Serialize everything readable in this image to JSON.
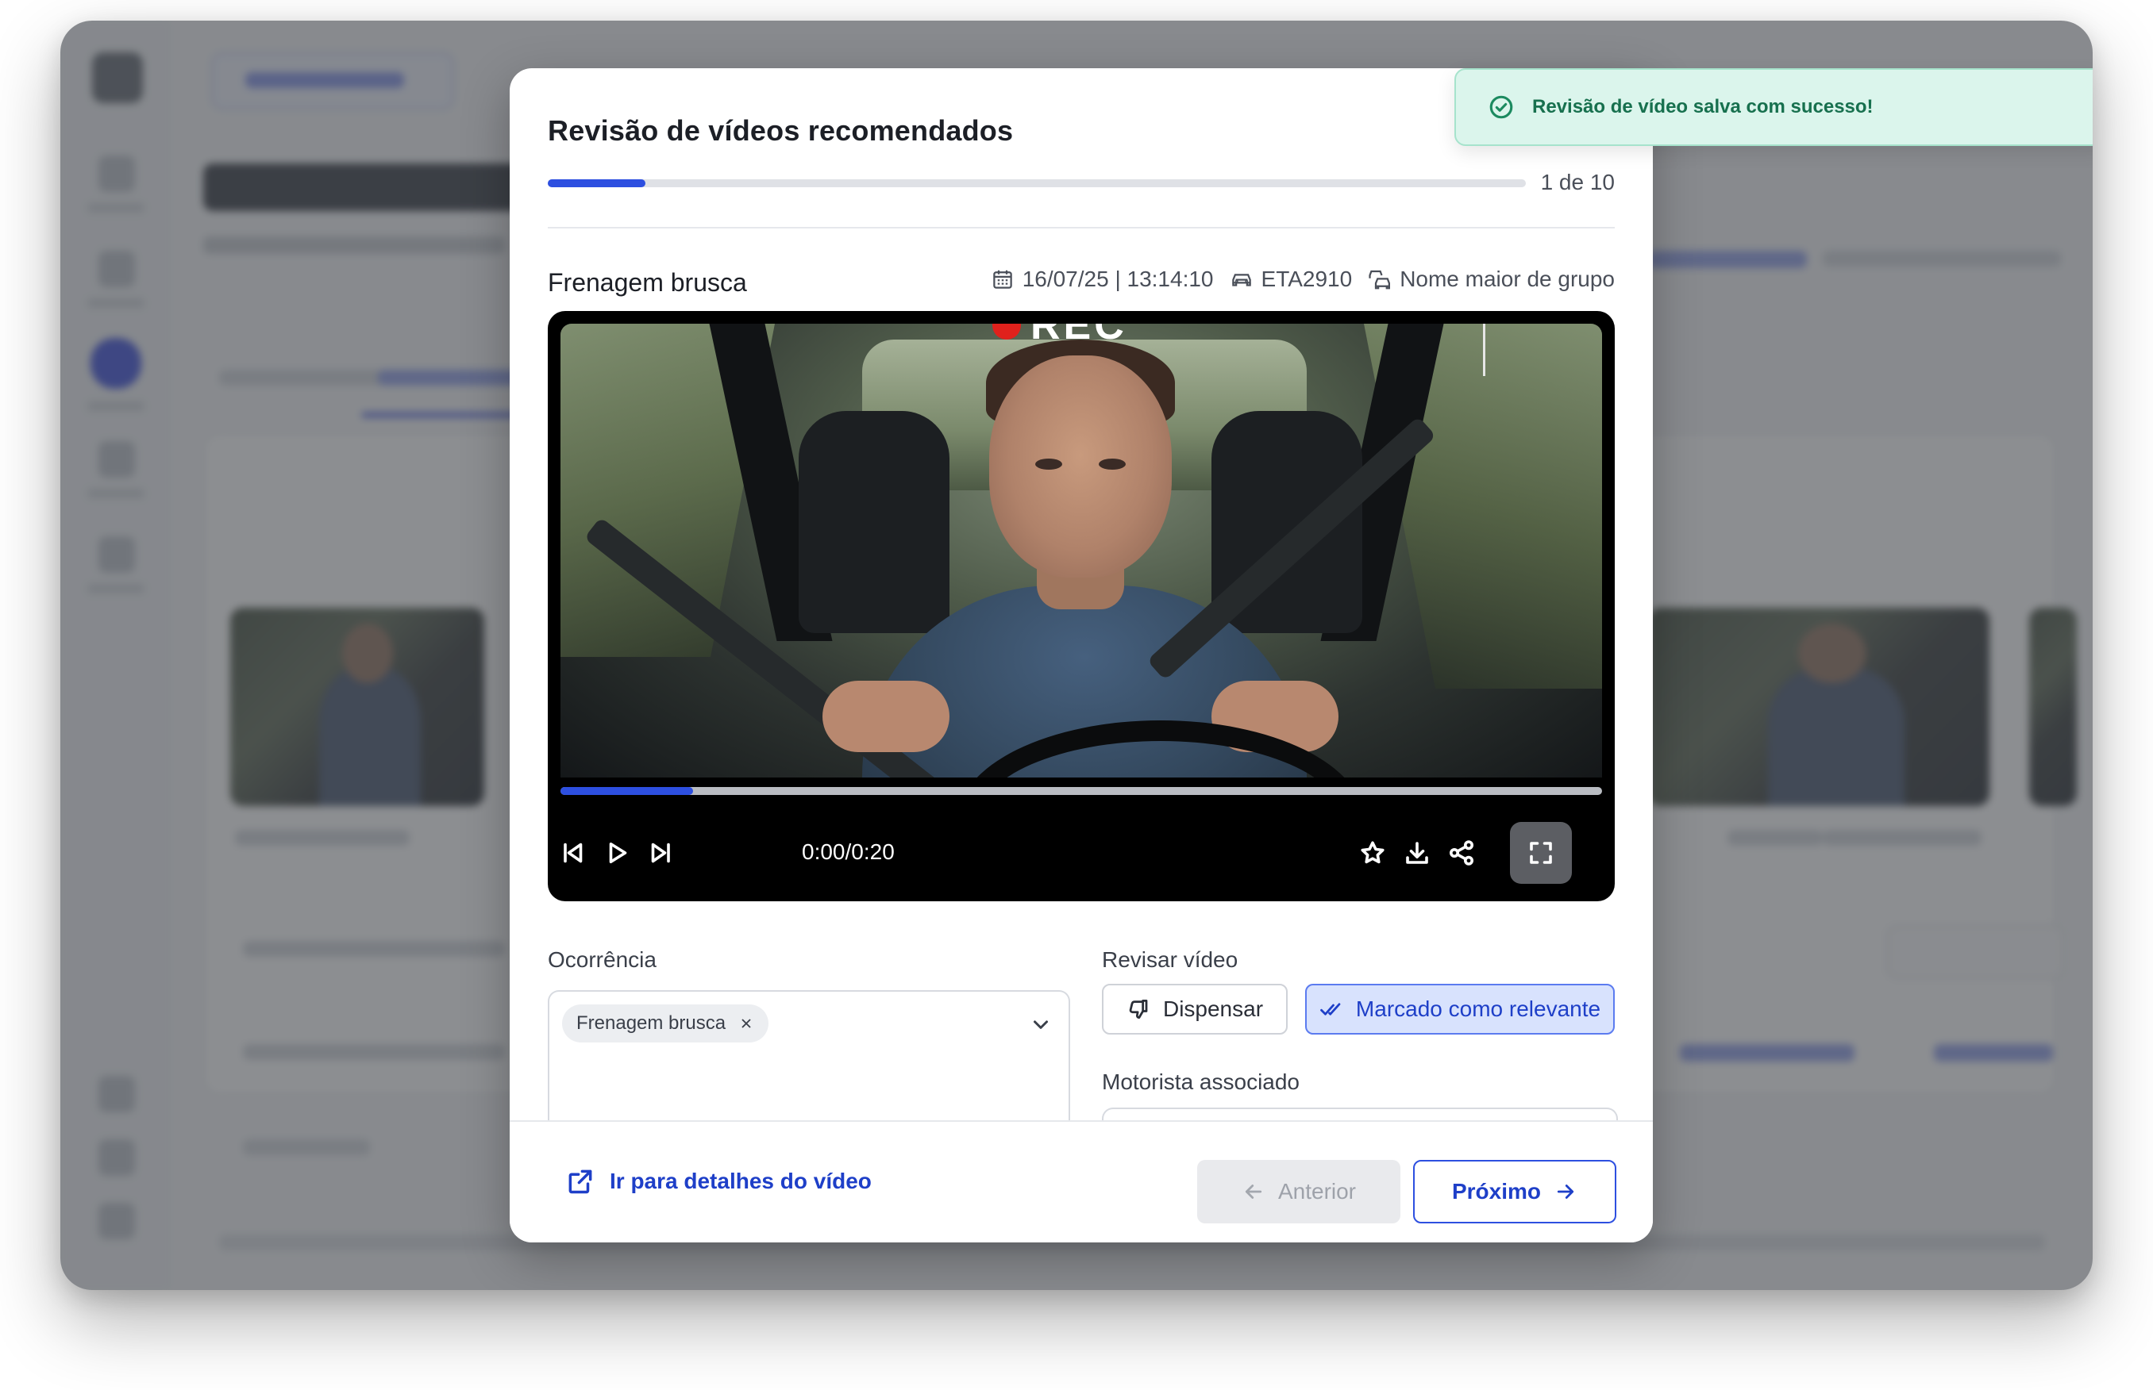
{
  "modal": {
    "title": "Revisão de vídeos recomendados",
    "progress_label": "1 de 10",
    "progress_current": 1,
    "progress_total": 10
  },
  "event": {
    "title": "Frenagem brusca",
    "datetime": "16/07/25 | 13:14:10",
    "vehicle": "ETA2910",
    "group": "Nome maior de grupo"
  },
  "player": {
    "overlay_text": "REC",
    "time": "0:00/0:20",
    "playback_progress": 0.127
  },
  "form": {
    "occurrence_label": "Ocorrência",
    "occurrence_chip": "Frenagem brusca",
    "review_label": "Revisar vídeo",
    "dismiss_label": "Dispensar",
    "relevant_label": "Marcado como relevante",
    "driver_label": "Motorista associado"
  },
  "footer": {
    "details_link": "Ir para detalhes do vídeo",
    "prev_label": "Anterior",
    "next_label": "Próximo"
  },
  "toast": {
    "message": "Revisão de vídeo salva com sucesso!"
  },
  "colors": {
    "accent": "#2d4fe0",
    "link": "#1e3fc8",
    "success_bg": "#dbf5ec",
    "success_text": "#17704e",
    "rec_dot": "#e0211c"
  },
  "icons": {
    "date": "calendar-icon",
    "vehicle": "car-icon",
    "group": "car-group-icon",
    "prev": "skip-back-icon",
    "play": "play-icon",
    "next": "skip-forward-icon",
    "favorite": "star-icon",
    "download": "download-icon",
    "share": "share-icon",
    "fullscreen": "fullscreen-icon",
    "dismiss": "thumbs-down-icon",
    "relevant": "double-check-icon",
    "external": "external-link-icon",
    "success": "check-circle-icon"
  }
}
